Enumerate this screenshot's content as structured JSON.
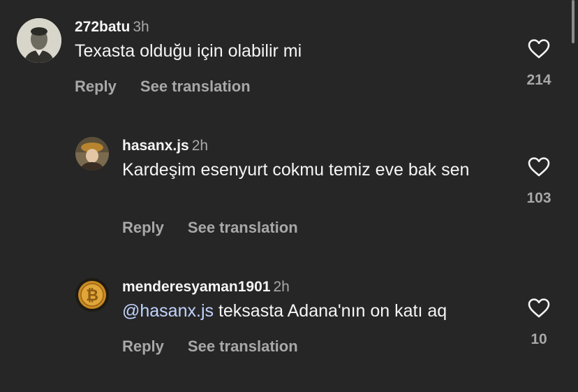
{
  "comments": [
    {
      "username": "272batu",
      "time": "3h",
      "text": "Texasta olduğu için olabilir mi",
      "reply_label": "Reply",
      "translate_label": "See translation",
      "likes": "214"
    },
    {
      "username": "hasanx.js",
      "time": "2h",
      "text": "Kardeşim esenyurt cokmu temiz eve bak sen",
      "reply_label": "Reply",
      "translate_label": "See translation",
      "likes": "103"
    },
    {
      "username": "menderesyaman1901",
      "time": "2h",
      "mention": "@hasanx.js",
      "text": " teksasta Adana'nın on katı aq",
      "reply_label": "Reply",
      "translate_label": "See translation",
      "likes": "10"
    }
  ],
  "icons": {
    "like": "heart-outline-icon"
  },
  "colors": {
    "background": "#262626",
    "text": "#f5f5f5",
    "secondary": "#a8a8a8",
    "mention": "#c2d4ff"
  }
}
